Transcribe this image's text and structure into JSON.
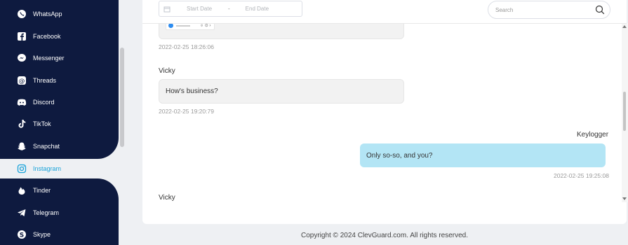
{
  "sidebar": {
    "items": [
      {
        "label": "WhatsApp",
        "icon": "whatsapp-icon"
      },
      {
        "label": "Facebook",
        "icon": "facebook-icon"
      },
      {
        "label": "Messenger",
        "icon": "messenger-icon"
      },
      {
        "label": "Threads",
        "icon": "threads-icon"
      },
      {
        "label": "Discord",
        "icon": "discord-icon"
      },
      {
        "label": "TikTok",
        "icon": "tiktok-icon"
      },
      {
        "label": "Snapchat",
        "icon": "snapchat-icon"
      },
      {
        "label": "Instagram",
        "icon": "instagram-icon",
        "active": true
      },
      {
        "label": "Tinder",
        "icon": "tinder-icon"
      },
      {
        "label": "Telegram",
        "icon": "telegram-icon"
      },
      {
        "label": "Skype",
        "icon": "skype-icon"
      }
    ],
    "colors": {
      "background": "#0e1a3f",
      "active": "#1aa3d9"
    }
  },
  "filters": {
    "start_placeholder": "Start Date",
    "separator": "-",
    "end_placeholder": "End Date",
    "search_placeholder": "Search"
  },
  "messages": [
    {
      "type": "incoming-media",
      "timestamp": "2022-02-25 18:26:06"
    },
    {
      "type": "incoming",
      "sender": "Vicky",
      "text": "How's business?",
      "timestamp": "2022-02-25 19:20:79"
    },
    {
      "type": "outgoing",
      "sender": "Keylogger",
      "text": "Only so-so, and you?",
      "timestamp": "2022-02-25 19:25:08"
    },
    {
      "type": "incoming",
      "sender": "Vicky"
    }
  ],
  "footer": {
    "copyright": "Copyright © 2024 ClevGuard.com. All rights reserved."
  }
}
